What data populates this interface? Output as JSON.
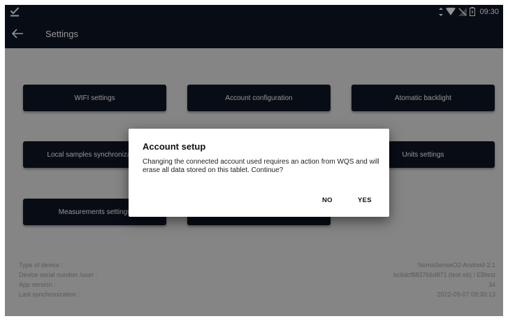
{
  "status_bar": {
    "time": "09:30",
    "icons": [
      "download-done-icon",
      "vibrate-icon",
      "wifi-icon",
      "no-sim-icon",
      "battery-icon"
    ]
  },
  "app_bar": {
    "back_icon": "arrow-left-icon",
    "title": "Settings"
  },
  "settings_buttons": [
    {
      "label": "WIFI settings"
    },
    {
      "label": "Account configuration"
    },
    {
      "label": "Atomatic backlight"
    },
    {
      "label": "Local samples synchronization"
    },
    {
      "label": "Units settings"
    },
    {
      "label": "Measurements settings"
    },
    {
      "label": ""
    }
  ],
  "device_info": [
    {
      "label": "Type of device :",
      "value": "NomaSenseO2-Android-2.1"
    },
    {
      "label": "Device serial number /user :",
      "value": "bc6dcf883766d871 (test eb) / EBtest"
    },
    {
      "label": "App version :",
      "value": "34"
    },
    {
      "label": "Last synchronization :",
      "value": "2022-09-07 09:30:13"
    }
  ],
  "dialog": {
    "title": "Account setup",
    "message": "Changing the connected account used requires an action from WQS and will erase all data stored on this tablet. Continue?",
    "no_label": "NO",
    "yes_label": "YES"
  },
  "colors": {
    "dark_navy": "#0e1525",
    "background": "#e6e6e6",
    "info_text": "#9a9a9a"
  }
}
